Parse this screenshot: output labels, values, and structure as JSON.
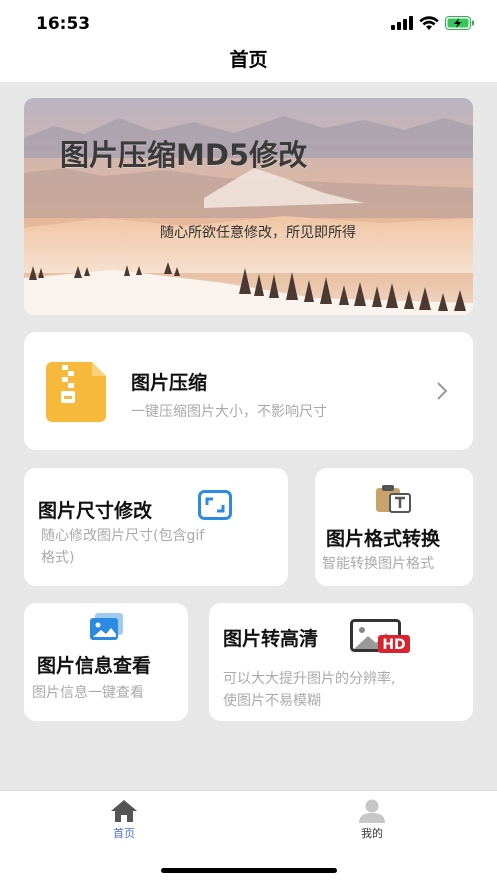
{
  "status": {
    "time": "16:53"
  },
  "nav": {
    "title": "首页"
  },
  "banner": {
    "title": "图片压缩MD5修改",
    "subtitle": "随心所欲任意修改，所见即所得"
  },
  "cards": {
    "compress": {
      "title": "图片压缩",
      "subtitle": "一键压缩图片大小，不影响尺寸",
      "icon": "zip-file-icon"
    },
    "resize": {
      "title": "图片尺寸修改",
      "subtitle_line1": "随心修改图片尺寸(包含gif",
      "subtitle_line2": "格式)",
      "icon": "resize-icon"
    },
    "convert": {
      "title": "图片格式转换",
      "subtitle": "智能转换图片格式",
      "icon": "clipboard-text-icon"
    },
    "info": {
      "title": "图片信息查看",
      "subtitle": "图片信息一键查看",
      "icon": "image-card-icon"
    },
    "hd": {
      "title": "图片转高清",
      "subtitle_line1": "可以大大提升图片的分辨率,",
      "subtitle_line2": "使图片不易模糊",
      "badge": "HD",
      "icon": "hd-image-icon"
    }
  },
  "tabbar": {
    "home": {
      "label": "首页",
      "active_color": "#4a6fd6"
    },
    "mine": {
      "label": "我的"
    }
  },
  "colors": {
    "background": "#e7e7e7",
    "accent_blue": "#2b8be0",
    "zip_yellow": "#f6b93b",
    "hd_red": "#d9232e"
  }
}
